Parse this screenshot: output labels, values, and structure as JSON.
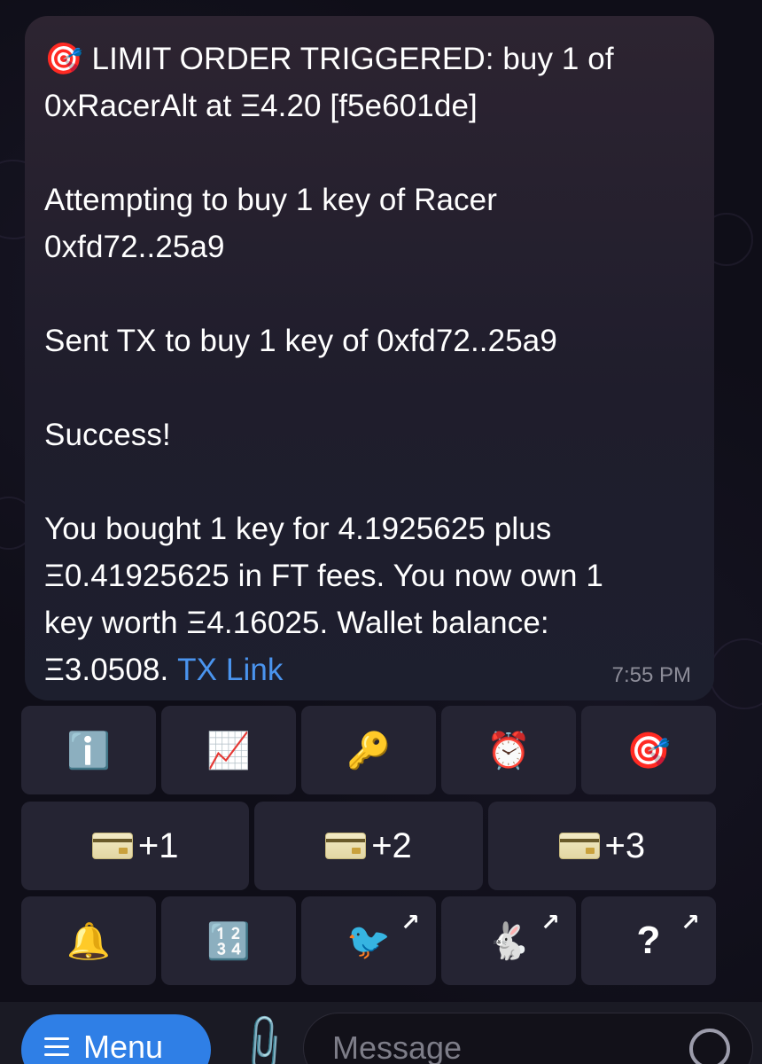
{
  "message": {
    "line1_emoji": "🎯",
    "line1": "LIMIT ORDER TRIGGERED: buy 1 of",
    "line2": "0xRacerAlt at Ξ4.20 [f5e601de]",
    "para2_line1": "Attempting to buy 1 key of Racer",
    "para2_line2": "0xfd72..25a9",
    "para3": "Sent TX to buy 1 key of 0xfd72..25a9",
    "para4": "Success!",
    "para5_line1": "You bought 1 key for 4.1925625 plus",
    "para5_line2": "Ξ0.41925625 in FT fees. You now own 1",
    "para5_line3": "key worth Ξ4.16025. Wallet balance:",
    "para5_line4": "Ξ3.0508.",
    "link_text": "TX Link",
    "time": "7:55 PM"
  },
  "keyboard": {
    "row1": [
      {
        "icon": "ℹ️",
        "name": "info-icon"
      },
      {
        "icon": "📈",
        "name": "chart-increasing-icon"
      },
      {
        "icon": "🔑",
        "name": "key-icon"
      },
      {
        "icon": "⏰",
        "name": "alarm-clock-icon"
      },
      {
        "icon": "🎯",
        "name": "target-icon"
      }
    ],
    "row2": [
      {
        "label": "+1"
      },
      {
        "label": "+2"
      },
      {
        "label": "+3"
      }
    ],
    "row3": [
      {
        "icon": "🔔",
        "name": "bell-icon"
      },
      {
        "icon": "🔢",
        "name": "input-numbers-icon"
      },
      {
        "icon": "🐦",
        "name": "bird-icon"
      },
      {
        "icon": "🐇",
        "name": "rabbit-icon"
      },
      {
        "icon": "?",
        "name": "question-icon"
      }
    ],
    "external_arrow": "↗"
  },
  "composer": {
    "menu_label": "Menu",
    "message_placeholder": "Message"
  },
  "colors": {
    "link": "#4a94ee",
    "menu_button": "#2f7fe6",
    "bubble": "#2a2433",
    "key_button": "#252433"
  }
}
